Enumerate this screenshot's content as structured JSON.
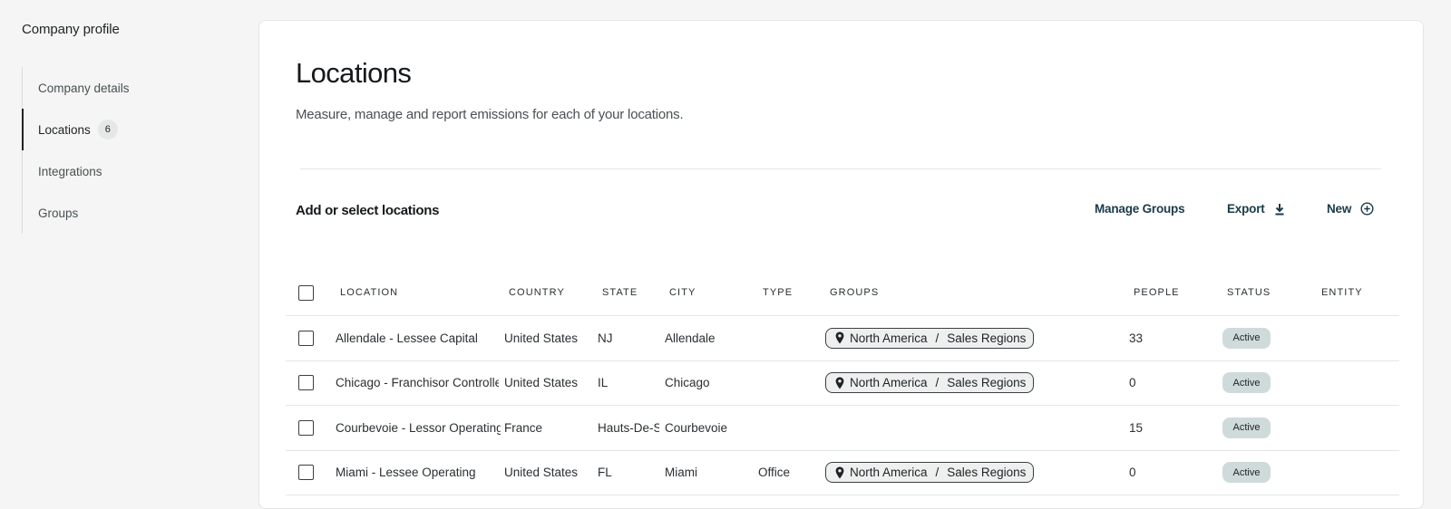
{
  "sidebar": {
    "title": "Company profile",
    "items": [
      {
        "label": "Company details"
      },
      {
        "label": "Locations",
        "badge": "6"
      },
      {
        "label": "Integrations"
      },
      {
        "label": "Groups"
      }
    ]
  },
  "page": {
    "title": "Locations",
    "subtitle": "Measure, manage and report emissions for each of your locations."
  },
  "section": {
    "title": "Add or select locations",
    "manage_groups": "Manage Groups",
    "export": "Export",
    "new": "New"
  },
  "table": {
    "headers": {
      "location": "LOCATION",
      "country": "COUNTRY",
      "state": "STATE",
      "city": "CITY",
      "type": "TYPE",
      "groups": "GROUPS",
      "people": "PEOPLE",
      "status": "STATUS",
      "entity": "ENTITY"
    },
    "rows": [
      {
        "location": "Allendale - Lessee Capital",
        "country": "United States",
        "state": "NJ",
        "city": "Allendale",
        "type": "",
        "group_region": "North America",
        "group_category": "Sales Regions",
        "people": "33",
        "status": "Active",
        "entity": ""
      },
      {
        "location": "Chicago - Franchisor Controlled",
        "country": "United States",
        "state": "IL",
        "city": "Chicago",
        "type": "",
        "group_region": "North America",
        "group_category": "Sales Regions",
        "people": "0",
        "status": "Active",
        "entity": ""
      },
      {
        "location": "Courbevoie - Lessor Operating",
        "country": "France",
        "state": "Hauts-De-Seine",
        "city": "Courbevoie",
        "type": "",
        "group_region": "",
        "group_category": "",
        "people": "15",
        "status": "Active",
        "entity": ""
      },
      {
        "location": "Miami - Lessee Operating",
        "country": "United States",
        "state": "FL",
        "city": "Miami",
        "type": "Office",
        "group_region": "North America",
        "group_category": "Sales Regions",
        "people": "0",
        "status": "Active",
        "entity": ""
      }
    ],
    "group_separator": "/"
  },
  "colors": {
    "accent": "#1b3a4b",
    "status_bg": "#cfdadb",
    "page_bg": "#f4f5f4"
  },
  "icons": {
    "export": "download-icon",
    "new": "plus-circle-icon",
    "group": "map-pin-icon"
  }
}
